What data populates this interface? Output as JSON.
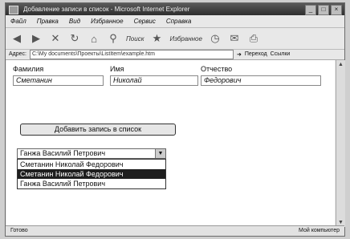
{
  "window": {
    "title": "Добавление записи в список - Microsoft Internet Explorer",
    "buttons": {
      "minimize": "_",
      "maximize": "□",
      "close": "×"
    }
  },
  "menubar": [
    "Файл",
    "Правка",
    "Вид",
    "Избранное",
    "Сервис",
    "Справка"
  ],
  "toolbar": {
    "search_label": "Поиск",
    "favorites_label": "Избранное"
  },
  "address": {
    "label": "Адрес:",
    "value": "C:\\My documents\\Проекты\\ListItem\\example.htm",
    "go_label": "Переход",
    "links_label": "Ссылки"
  },
  "form": {
    "labels": {
      "last": "Фамилия",
      "first": "Имя",
      "patronymic": "Отчество"
    },
    "values": {
      "last": "Сметанин",
      "first": "Николай",
      "patronymic": "Федорович"
    },
    "add_button": "Добавить запись в список"
  },
  "combo": {
    "selected": "Ганжа Василий Петрович",
    "options": [
      "Сметанин Николай Федорович",
      "Сметанин Николай Федорович",
      "Ганжа Василий Петрович"
    ],
    "highlighted_index": 1
  },
  "status": {
    "left": "Готово",
    "right": "Мой компьютер"
  }
}
